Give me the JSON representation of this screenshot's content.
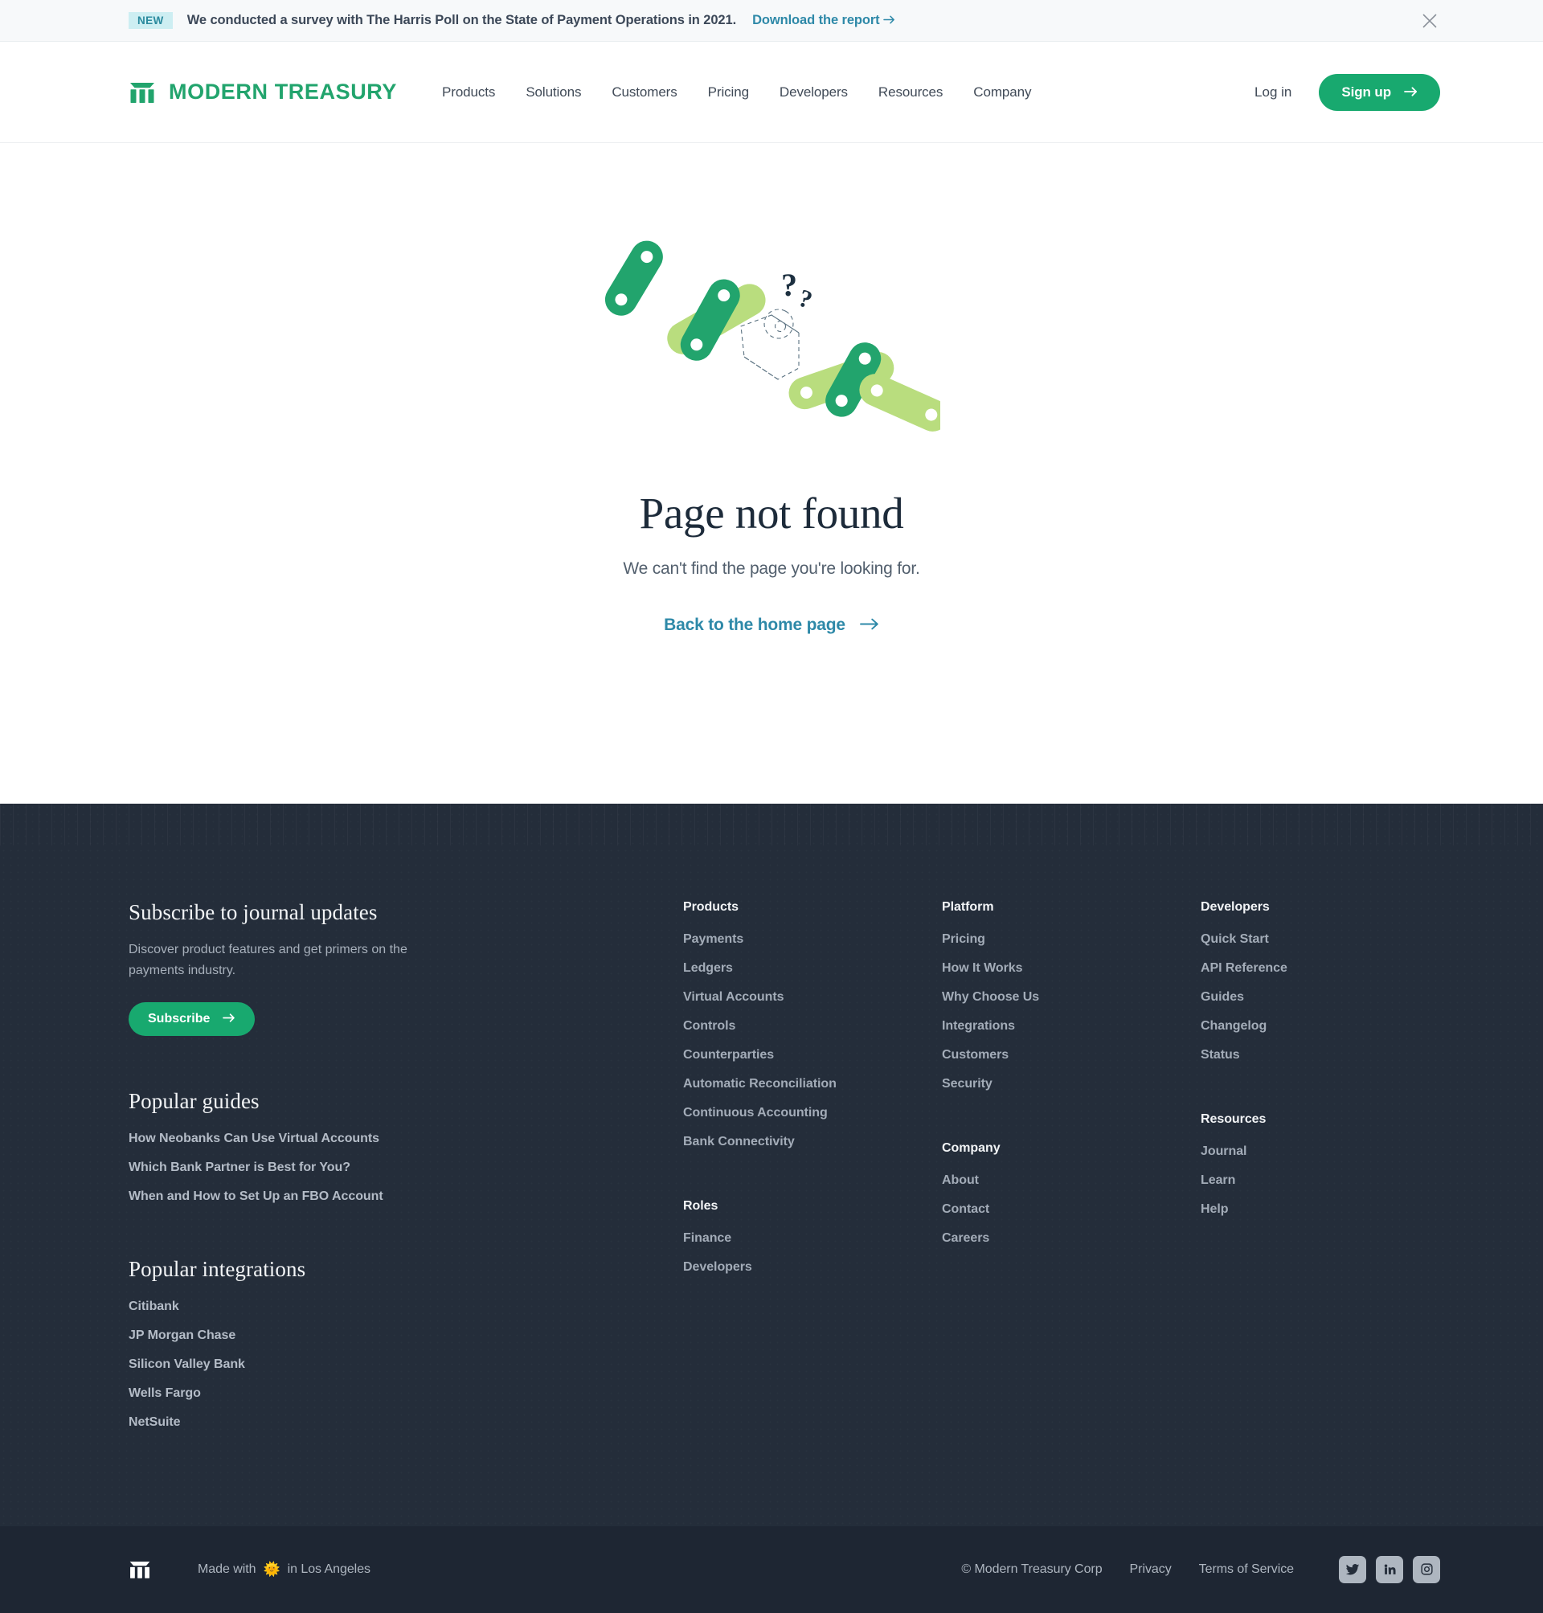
{
  "banner": {
    "badge": "NEW",
    "text": "We conducted a survey with The Harris Poll on the State of Payment Operations in 2021.",
    "link": "Download the report",
    "close_icon": "close-icon",
    "badge_bg": "#cdeef2",
    "badge_color": "#2a8a9e",
    "link_color": "#2e89a8"
  },
  "header": {
    "brand": "MODERN TREASURY",
    "brand_color": "#22a46d",
    "nav": [
      {
        "label": "Products"
      },
      {
        "label": "Solutions"
      },
      {
        "label": "Customers"
      },
      {
        "label": "Pricing"
      },
      {
        "label": "Developers"
      },
      {
        "label": "Resources"
      },
      {
        "label": "Company"
      }
    ],
    "login": "Log in",
    "signup": "Sign up",
    "signup_bg": "#18a96f"
  },
  "main": {
    "title": "Page not found",
    "subtitle": "We can't find the page you're looking for.",
    "home_link": "Back to the home page",
    "home_link_color": "#2e89a8",
    "illustration": "broken-chain-links-illustration",
    "illustration_colors": {
      "dark_green": "#22a46d",
      "light_green": "#b9dd7e",
      "outline": "#3f5a6c"
    }
  },
  "footer": {
    "subscribe": {
      "heading": "Subscribe to journal updates",
      "description": "Discover product features and get primers on the payments industry.",
      "button": "Subscribe"
    },
    "popular_guides": {
      "heading": "Popular guides",
      "items": [
        "How Neobanks Can Use Virtual Accounts",
        "Which Bank Partner is Best for You?",
        "When and How to Set Up an FBO Account"
      ]
    },
    "popular_integrations": {
      "heading": "Popular integrations",
      "items": [
        "Citibank",
        "JP Morgan Chase",
        "Silicon Valley Bank",
        "Wells Fargo",
        "NetSuite"
      ]
    },
    "columns": [
      {
        "groups": [
          {
            "heading": "Products",
            "items": [
              "Payments",
              "Ledgers",
              "Virtual Accounts",
              "Controls",
              "Counterparties",
              "Automatic Reconciliation",
              "Continuous Accounting",
              "Bank Connectivity"
            ]
          },
          {
            "heading": "Roles",
            "items": [
              "Finance",
              "Developers"
            ]
          }
        ]
      },
      {
        "groups": [
          {
            "heading": "Platform",
            "items": [
              "Pricing",
              "How It Works",
              "Why Choose Us",
              "Integrations",
              "Customers",
              "Security"
            ]
          },
          {
            "heading": "Company",
            "items": [
              "About",
              "Contact",
              "Careers"
            ]
          }
        ]
      },
      {
        "groups": [
          {
            "heading": "Developers",
            "items": [
              "Quick Start",
              "API Reference",
              "Guides",
              "Changelog",
              "Status"
            ]
          },
          {
            "heading": "Resources",
            "items": [
              "Journal",
              "Learn",
              "Help"
            ]
          }
        ]
      }
    ],
    "bottom": {
      "made_with_prefix": "Made with",
      "made_with_emoji": "🌞",
      "made_with_suffix": "in Los Angeles",
      "copyright": "© Modern Treasury Corp",
      "privacy": "Privacy",
      "terms": "Terms of Service",
      "socials": [
        {
          "name": "twitter-icon"
        },
        {
          "name": "linkedin-icon"
        },
        {
          "name": "instagram-icon"
        }
      ]
    }
  }
}
